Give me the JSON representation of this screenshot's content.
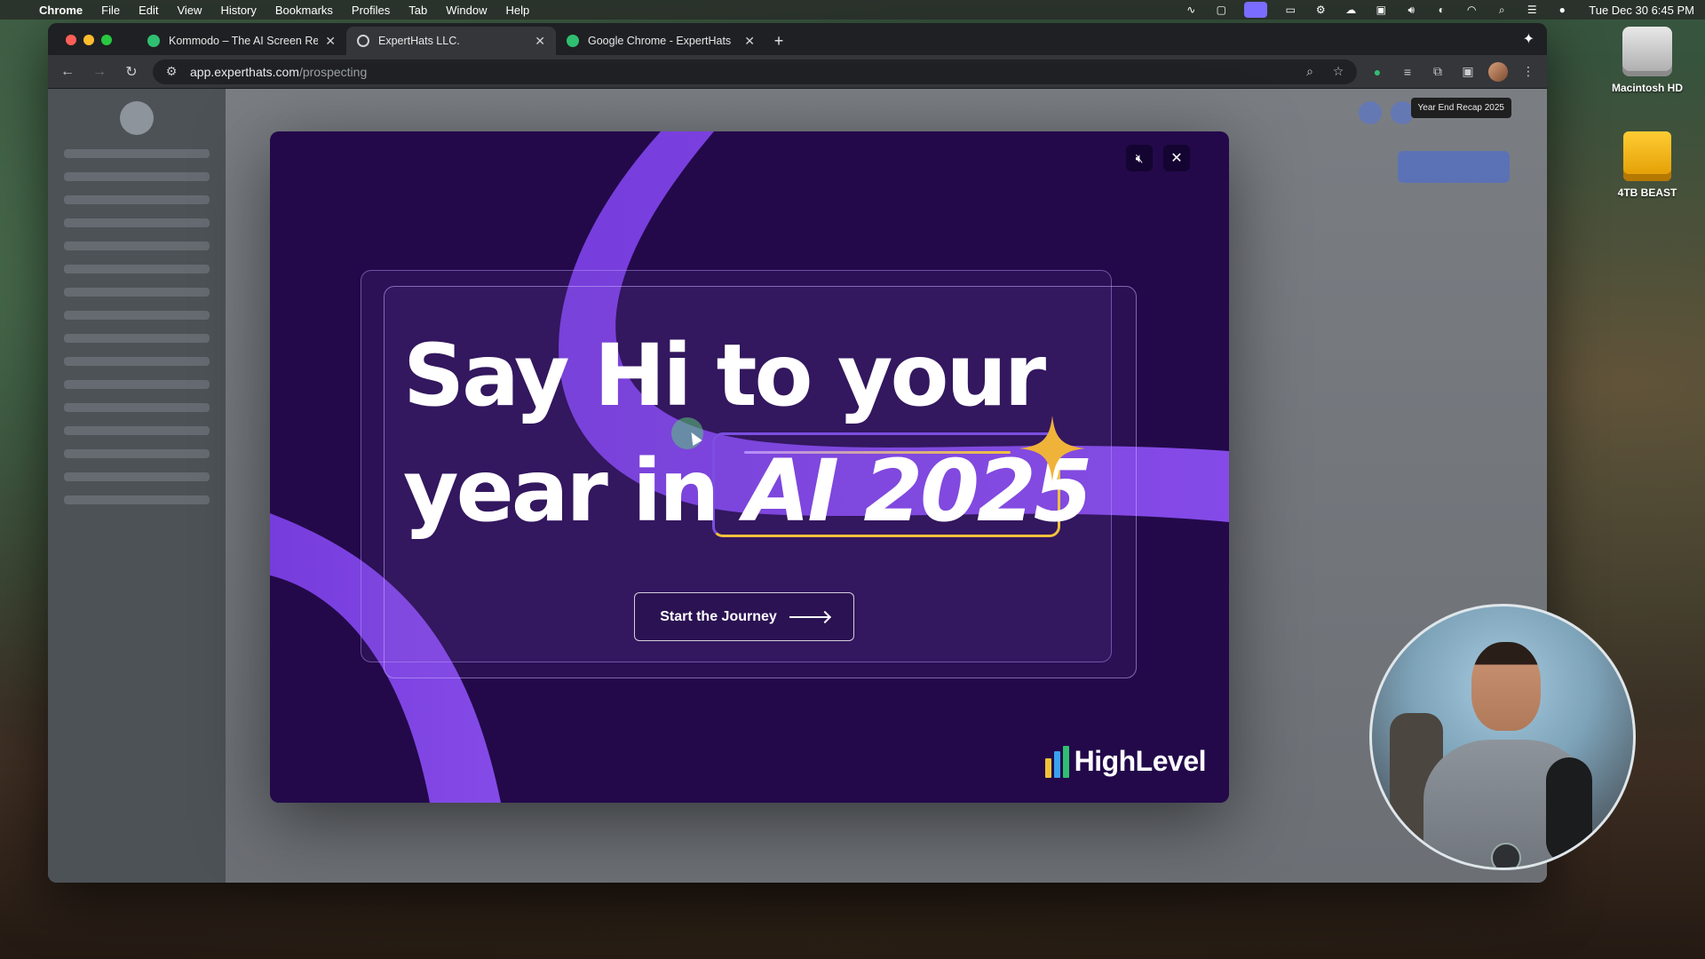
{
  "menubar": {
    "app_name": "Chrome",
    "items": [
      "File",
      "Edit",
      "View",
      "History",
      "Bookmarks",
      "Profiles",
      "Tab",
      "Window",
      "Help"
    ],
    "clock": "Tue Dec 30  6:45 PM"
  },
  "desktop": {
    "icons": [
      {
        "label": "Macintosh HD",
        "icon": "hard-drive-icon"
      },
      {
        "label": "4TB BEAST",
        "icon": "external-drive-icon"
      }
    ]
  },
  "browser": {
    "tabs": [
      {
        "title": "Kommodo – The AI Screen Re",
        "icon": "kommodo-favicon",
        "active": false
      },
      {
        "title": "ExpertHats LLC.",
        "icon": "globe-favicon",
        "active": true
      },
      {
        "title": "Google Chrome - ExpertHats",
        "icon": "chrome-favicon",
        "active": false
      }
    ],
    "url_host": "app.experthats.com",
    "url_path": "/prospecting"
  },
  "page": {
    "tooltip": "Year End Recap 2025"
  },
  "modal": {
    "headline_line1": "Say Hi to your",
    "headline_line2_prefix": "year in",
    "headline_highlight": "AI 2025",
    "cta_label": "Start the Journey",
    "brand": "HighLevel",
    "colors": {
      "background": "#23094a",
      "swoosh": "#7b3fe4",
      "accent_gold": "#f0c23a"
    }
  }
}
